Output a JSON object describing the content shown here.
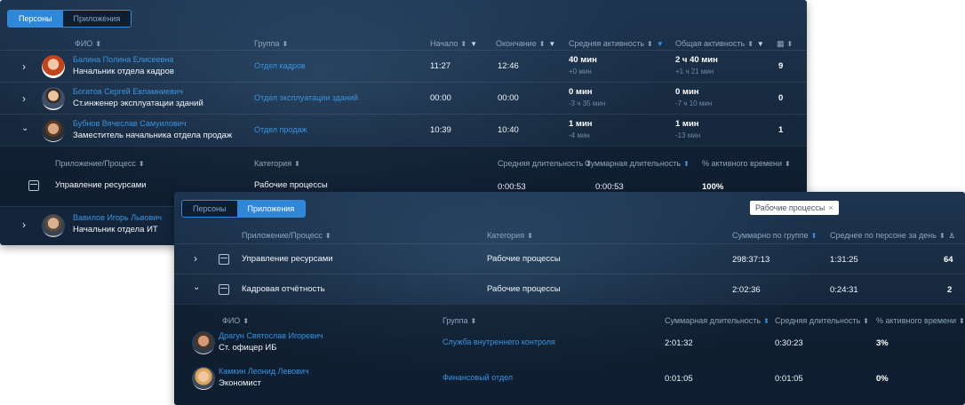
{
  "panel_a": {
    "tabs": [
      "Персоны",
      "Приложения"
    ],
    "headers": {
      "fio": "ФИО",
      "group": "Группа",
      "start": "Начало",
      "end": "Окончание",
      "avg": "Средняя активность",
      "total": "Общая активность"
    },
    "persons": [
      {
        "name": "Балина Полина Елисеевна",
        "title": "Начальник отдела кадров",
        "group": "Отдел кадров",
        "start": "11:27",
        "end": "12:46",
        "avg": "40 мин",
        "avg_delta": "+0 мин",
        "total": "2 ч 40 мин",
        "total_delta": "+1 ч 21 мин",
        "count": "9"
      },
      {
        "name": "Богатов Сергей Евламниевич",
        "title": "Ст.инженер эксплуатации зданий",
        "group": "Отдел эксплуатации зданий",
        "start": "00:00",
        "end": "00:00",
        "avg": "0 мин",
        "avg_delta": "-3 ч 35 мин",
        "total": "0 мин",
        "total_delta": "-7 ч 10 мин",
        "count": "0"
      },
      {
        "name": "Бубнов Вячеслав Самуилович",
        "title": "Заместитель начальника отдела продаж",
        "group": "Отдел продаж",
        "start": "10:39",
        "end": "10:40",
        "avg": "1 мин",
        "avg_delta": "-4 мин",
        "total": "1 мин",
        "total_delta": "-13 мин",
        "count": "1"
      }
    ],
    "sub_headers": {
      "app": "Приложение/Процесс",
      "category": "Категория",
      "avg_dur": "Средняя длительность",
      "sum_dur": "Суммарная длительность",
      "active_pct": "% активного времени"
    },
    "sub_row": {
      "app": "Управление ресурсами",
      "category": "Рабочие процессы",
      "avg_dur": "0:00:53",
      "sum_dur": "0:00:53",
      "active_pct": "100%"
    },
    "last_person": {
      "name": "Вавилов Игорь Львович",
      "title": "Начальник отдела ИТ"
    }
  },
  "panel_b": {
    "tabs": [
      "Персоны",
      "Приложения"
    ],
    "filter_chip": "Рабочие процессы",
    "headers": {
      "app": "Приложение/Процесс",
      "category": "Категория",
      "sum_group": "Суммарно по группе",
      "avg_person": "Среднее по персоне за день"
    },
    "apps": [
      {
        "name": "Управление ресурсами",
        "category": "Рабочие процессы",
        "sum": "298:37:13",
        "avg": "1:31:25",
        "count": "64"
      },
      {
        "name": "Кадровая отчётность",
        "category": "Рабочие процессы",
        "sum": "2:02:36",
        "avg": "0:24:31",
        "count": "2"
      }
    ],
    "sub_headers": {
      "fio": "ФИО",
      "group": "Группа",
      "sum_dur": "Суммарная длительность",
      "avg_dur": "Средняя длительность",
      "active_pct": "% активного времени"
    },
    "persons": [
      {
        "name": "Драгун Святослав Игоревич",
        "title": "Ст. офицер ИБ",
        "group": "Служба внутреннего контроля",
        "sum": "2:01:32",
        "avg": "0:30:23",
        "pct": "3%"
      },
      {
        "name": "Камкин Леонид Левович",
        "title": "Экономист",
        "group": "Финансовый отдел",
        "sum": "0:01:05",
        "avg": "0:01:05",
        "pct": "0%"
      }
    ]
  }
}
